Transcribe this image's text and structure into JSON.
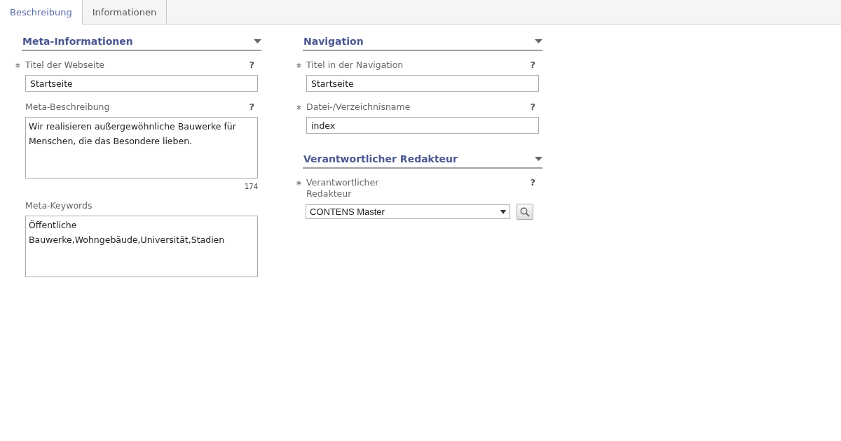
{
  "tabs": [
    {
      "label": "Beschreibung",
      "selected": true
    },
    {
      "label": "Informationen",
      "selected": false
    }
  ],
  "columns": [
    {
      "sections": [
        {
          "title": "Meta-Informationen",
          "expanded": true,
          "fields": [
            {
              "kind": "text",
              "label": "Titel der Webseite",
              "required": true,
              "help": "?",
              "value": "Startseite"
            },
            {
              "kind": "textarea",
              "label": "Meta-Beschreibung",
              "required": false,
              "help": "?",
              "value": "Wir realisieren außergewöhnliche Bauwerke für Menschen, die das Besondere lieben.",
              "counter": "174"
            },
            {
              "kind": "textarea",
              "label": "Meta-Keywords",
              "required": false,
              "value": "Öffentliche Bauwerke,Wohngebäude,Universität,Stadien"
            }
          ]
        }
      ]
    },
    {
      "sections": [
        {
          "title": "Navigation",
          "expanded": true,
          "fields": [
            {
              "kind": "text",
              "label": "Titel in der Navigation",
              "required": true,
              "help": "?",
              "value": "Startseite"
            },
            {
              "kind": "text",
              "label": "Datei-/Verzeichnisname",
              "required": true,
              "help": "?",
              "value": "index"
            }
          ]
        },
        {
          "title": "Verantwortlicher Redakteur",
          "expanded": true,
          "fields": [
            {
              "kind": "select",
              "label": "Verantwortlicher Redakteur",
              "required": true,
              "help": "?",
              "value": "CONTENS Master"
            }
          ]
        }
      ]
    }
  ]
}
